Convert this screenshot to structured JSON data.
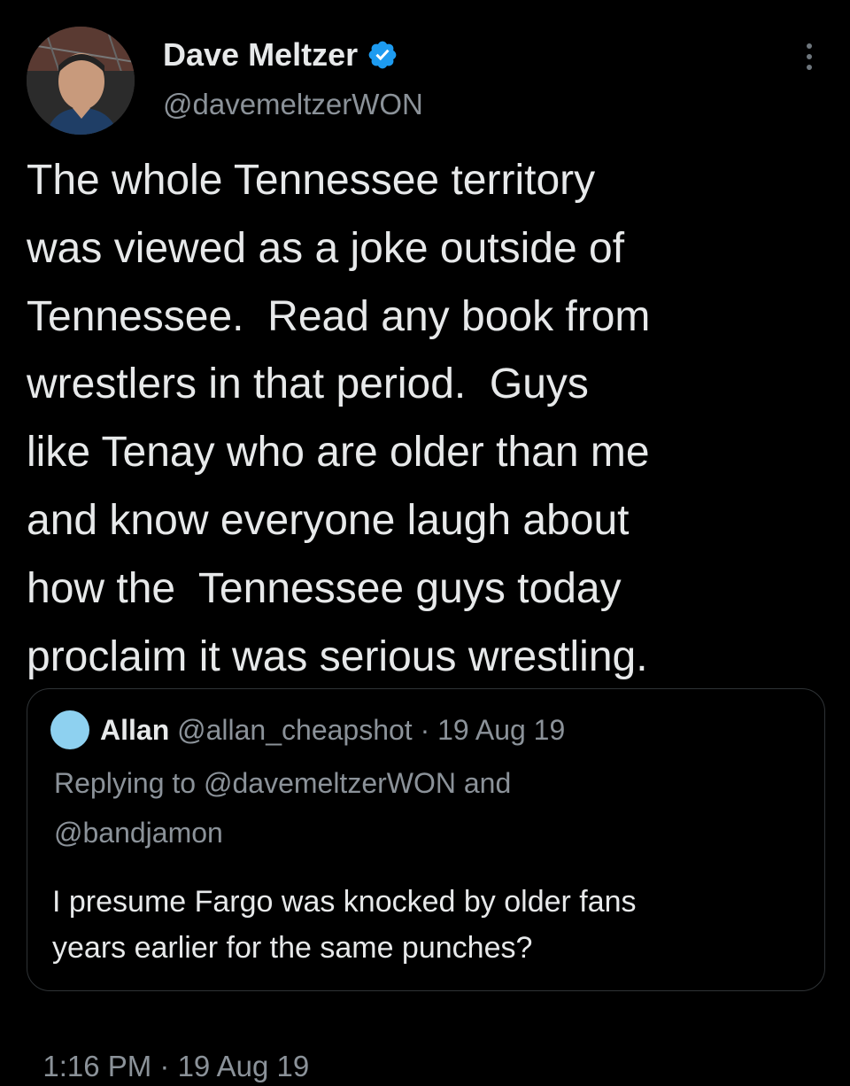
{
  "author": {
    "name": "Dave Meltzer",
    "handle": "@davemeltzerWON",
    "verified": true
  },
  "tweet": {
    "lines": [
      "The whole Tennessee territory",
      "was viewed as a joke outside of",
      "Tennessee.  Read any book from",
      "wrestlers in that period.  Guys",
      "like Tenay who are older than me",
      "and know everyone laugh about",
      "how the  Tennessee guys today",
      "proclaim it was serious wrestling."
    ]
  },
  "quoted": {
    "name": "Allan",
    "handle": "@allan_cheapshot",
    "separator": " · ",
    "date": "19 Aug 19",
    "reply_line1": "Replying to @davemeltzerWON and",
    "reply_line2": "@bandjamon",
    "lines": [
      "I presume Fargo was knocked by older fans",
      "years earlier for the same punches?"
    ]
  },
  "timestamp": {
    "time": "1:16 PM",
    "separator": " · ",
    "date": "19 Aug 19"
  },
  "colors": {
    "background": "#000000",
    "text_primary": "#e7e9ea",
    "text_secondary": "#8b9299",
    "verified_badge": "#1d9bf0",
    "card_border": "#2f3336"
  },
  "icons": {
    "verified": "verified-badge-icon",
    "more": "more-options-icon"
  }
}
